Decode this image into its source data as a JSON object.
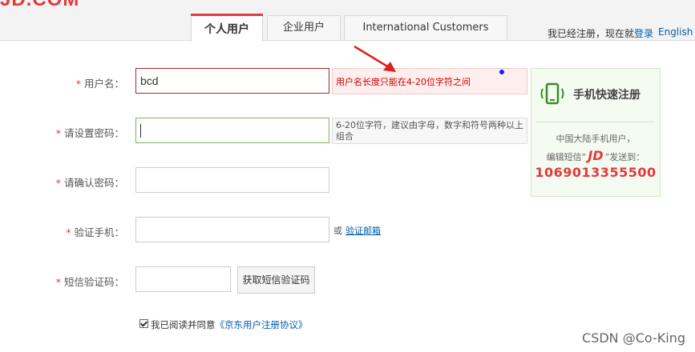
{
  "header": {
    "logo": "JD.COM",
    "tabs": [
      {
        "label": "个人用户",
        "active": true
      },
      {
        "label": "企业用户",
        "active": false
      },
      {
        "label": "International Customers",
        "active": false
      }
    ],
    "login_prompt": "我已经注册，现在就",
    "login_link": "登录",
    "english_link": "English"
  },
  "form": {
    "required_mark": "*",
    "username": {
      "label": "用户名：",
      "value": "bcd",
      "error": "用户名长度只能在4-20位字符之间"
    },
    "password": {
      "label": "请设置密码：",
      "value": "",
      "hint": "6-20位字符，建议由字母，数字和符号两种以上组合"
    },
    "confirm_password": {
      "label": "请确认密码：",
      "value": ""
    },
    "phone": {
      "label": "验证手机：",
      "value": "",
      "or_text": "或",
      "alt_link": "验证邮箱"
    },
    "sms_code": {
      "label": "短信验证码：",
      "value": "",
      "button": "获取短信验证码"
    },
    "agreement": {
      "checked": true,
      "text": "我已阅读并同意",
      "link": "《京东用户注册协议》"
    }
  },
  "sms_panel": {
    "title": "手机快速注册",
    "line1": "中国大陆手机用户，",
    "line2_pre": "编辑短信“",
    "line2_code": "JD",
    "line2_post": "”发送到：",
    "number": "1069013355500"
  },
  "watermark": "CSDN @Co-King",
  "colors": {
    "brand": "#e4393c",
    "link": "#005ea7",
    "arrow": "#e02020",
    "sms_panel_bg": "#f4fbf0"
  }
}
